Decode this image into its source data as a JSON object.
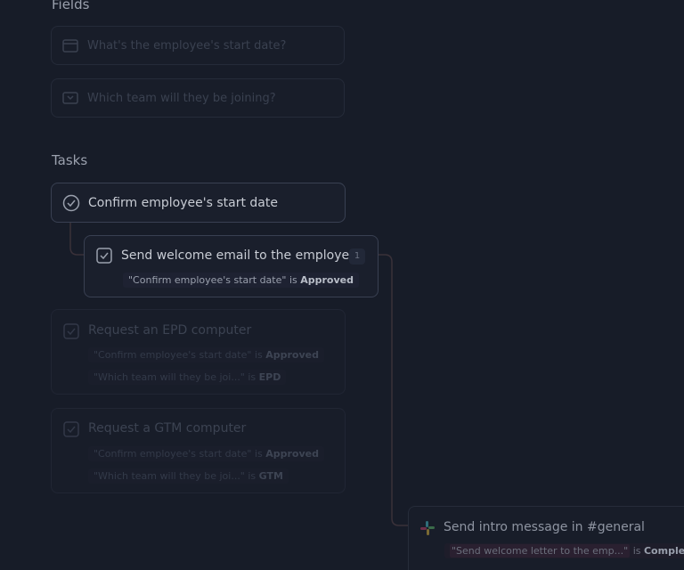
{
  "fields_section": {
    "title": "Fields",
    "fields": [
      {
        "placeholder": "What's the employee's start date?",
        "icon": "calendar-icon"
      },
      {
        "placeholder": "Which team will they be joining?",
        "icon": "dropdown-icon"
      }
    ]
  },
  "tasks_section": {
    "title": "Tasks",
    "tasks": [
      {
        "title": "Confirm employee's start date",
        "icon": "check-circle-icon"
      },
      {
        "title": "Send welcome email to the employee",
        "badge": "1",
        "condition": {
          "field": "\"Confirm employee's start date\"",
          "op": "is",
          "value": "Approved"
        }
      },
      {
        "title": "Request an EPD computer",
        "conditions": [
          {
            "field": "\"Confirm employee's start date\"",
            "op": "is",
            "value": "Approved"
          },
          {
            "field": "\"Which team will they be joi...\"",
            "op": "is",
            "value": "EPD"
          }
        ]
      },
      {
        "title": "Request a GTM computer",
        "conditions": [
          {
            "field": "\"Confirm employee's start date\"",
            "op": "is",
            "value": "Approved"
          },
          {
            "field": "\"Which team will they be joi...\"",
            "op": "is",
            "value": "GTM"
          }
        ]
      },
      {
        "title": "Send intro message in #general",
        "icon": "slack-icon",
        "condition": {
          "field": "\"Send welcome letter to the emp...\"",
          "op": "is",
          "value": "Completed"
        }
      }
    ]
  }
}
